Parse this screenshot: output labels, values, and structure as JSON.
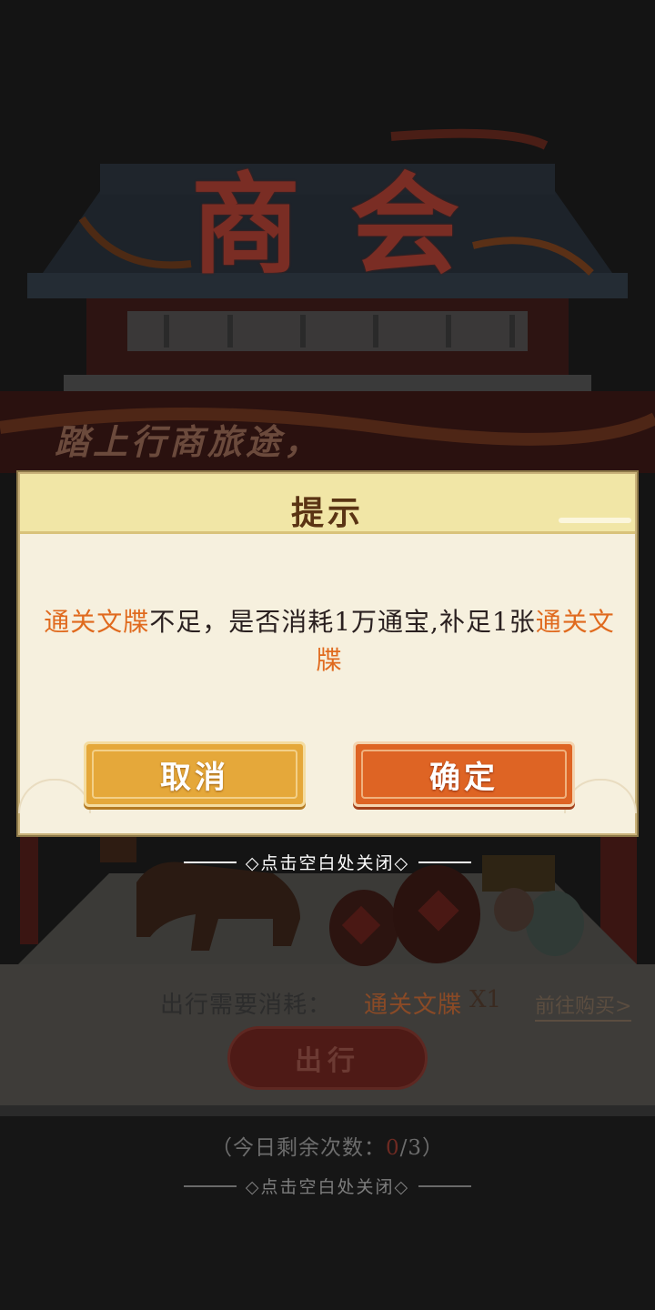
{
  "scene": {
    "title_chars": [
      "商",
      "会"
    ],
    "slogan": "踏上行商旅途，",
    "cost": {
      "label": "出行需要消耗：",
      "item": "通关文牒",
      "quantity": "X1",
      "buy_link": "前往购买>"
    },
    "depart_button": "出行",
    "remaining": {
      "prefix": "（今日剩余次数：",
      "used": "0",
      "suffix": "/3）"
    },
    "close_hint": "◇点击空白处关闭◇"
  },
  "dialog": {
    "title": "提示",
    "message": {
      "item_1": "通关文牒",
      "text_1": "不足，是否消耗1万通宝,补足1张",
      "item_2": "通关文牒"
    },
    "cancel_label": "取消",
    "confirm_label": "确定"
  },
  "overlay": {
    "close_hint": "◇点击空白处关闭◇"
  },
  "colors": {
    "highlight": "#e06a1e",
    "cancel_button": "#e5a83a",
    "confirm_button": "#de6424",
    "dialog_bg": "#f6f0de",
    "dialog_header": "#f1e6a6"
  }
}
